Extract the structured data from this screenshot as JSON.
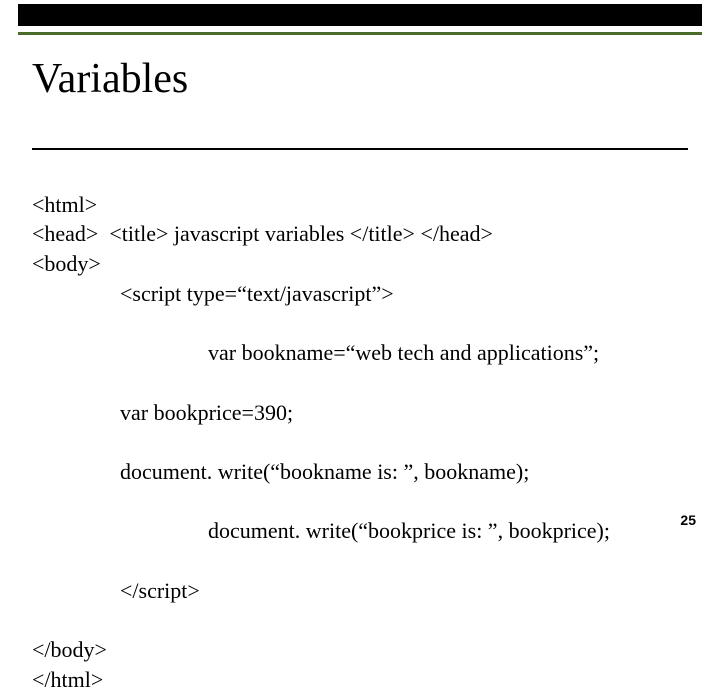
{
  "title": "Variables",
  "code": {
    "l1": "<html>",
    "l2": "<head>  <title> javascript variables </title> </head>",
    "l3": "<body>",
    "l4": "<script type=“text/javascript”>",
    "l5": "var bookname=“web tech and applications”;",
    "l6": "var bookprice=390;",
    "l7": "document. write(“bookname is: ”, bookname);",
    "l8": "document. write(“bookprice is: ”, bookprice);",
    "l9": "</script>",
    "l10": "</body>",
    "l11": "</html>"
  },
  "page_number": "25"
}
